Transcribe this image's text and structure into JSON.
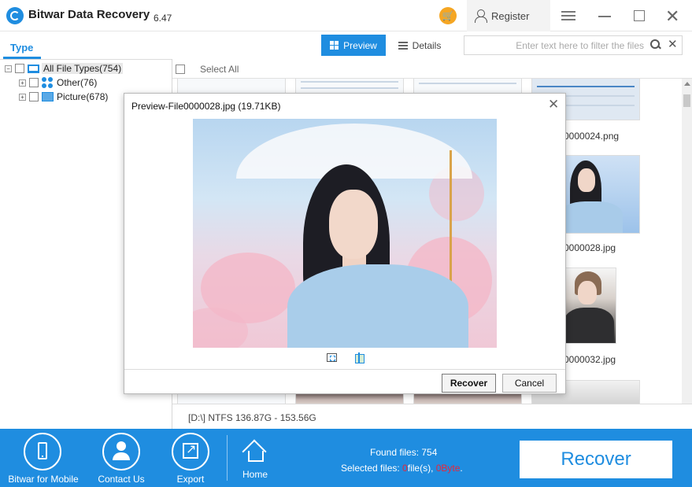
{
  "app": {
    "title": "Bitwar Data Recovery",
    "version": "6.47",
    "register_label": "Register",
    "colors": {
      "accent": "#1f8de0",
      "cart": "#f5a623",
      "highlight": "#e8263a"
    }
  },
  "left": {
    "tab_label": "Type",
    "tree": [
      {
        "label": "All File Types(754)",
        "icon": "computer-icon",
        "expanded": true
      },
      {
        "label": "Other(76)",
        "icon": "other-files-icon",
        "expanded": false
      },
      {
        "label": "Picture(678)",
        "icon": "picture-icon",
        "expanded": false
      }
    ]
  },
  "toolbar": {
    "preview_label": "Preview",
    "details_label": "Details",
    "filter_placeholder": "Enter text here to filter the files"
  },
  "content": {
    "select_all_label": "Select All",
    "visible_file_names": [
      "0000024.png",
      "0000028.jpg",
      "0000032.jpg"
    ],
    "path_info": "[D:\\] NTFS 136.87G - 153.56G"
  },
  "dialog": {
    "title": "Preview-File0000028.jpg (19.71KB)",
    "recover_label": "Recover",
    "cancel_label": "Cancel"
  },
  "bottom": {
    "items": [
      {
        "label": "Bitwar for Mobile",
        "icon": "mobile-phone-icon"
      },
      {
        "label": "Contact Us",
        "icon": "contact-icon"
      },
      {
        "label": "Export",
        "icon": "export-icon"
      },
      {
        "label": "Home",
        "icon": "home-icon"
      }
    ],
    "found_label": "Found files: ",
    "found_count": "754",
    "selected_label": "Selected files: ",
    "selected_count": "0",
    "selected_files_unit": "file(s), ",
    "selected_size": "0Byte",
    "selected_end": ".",
    "recover_label": "Recover"
  }
}
